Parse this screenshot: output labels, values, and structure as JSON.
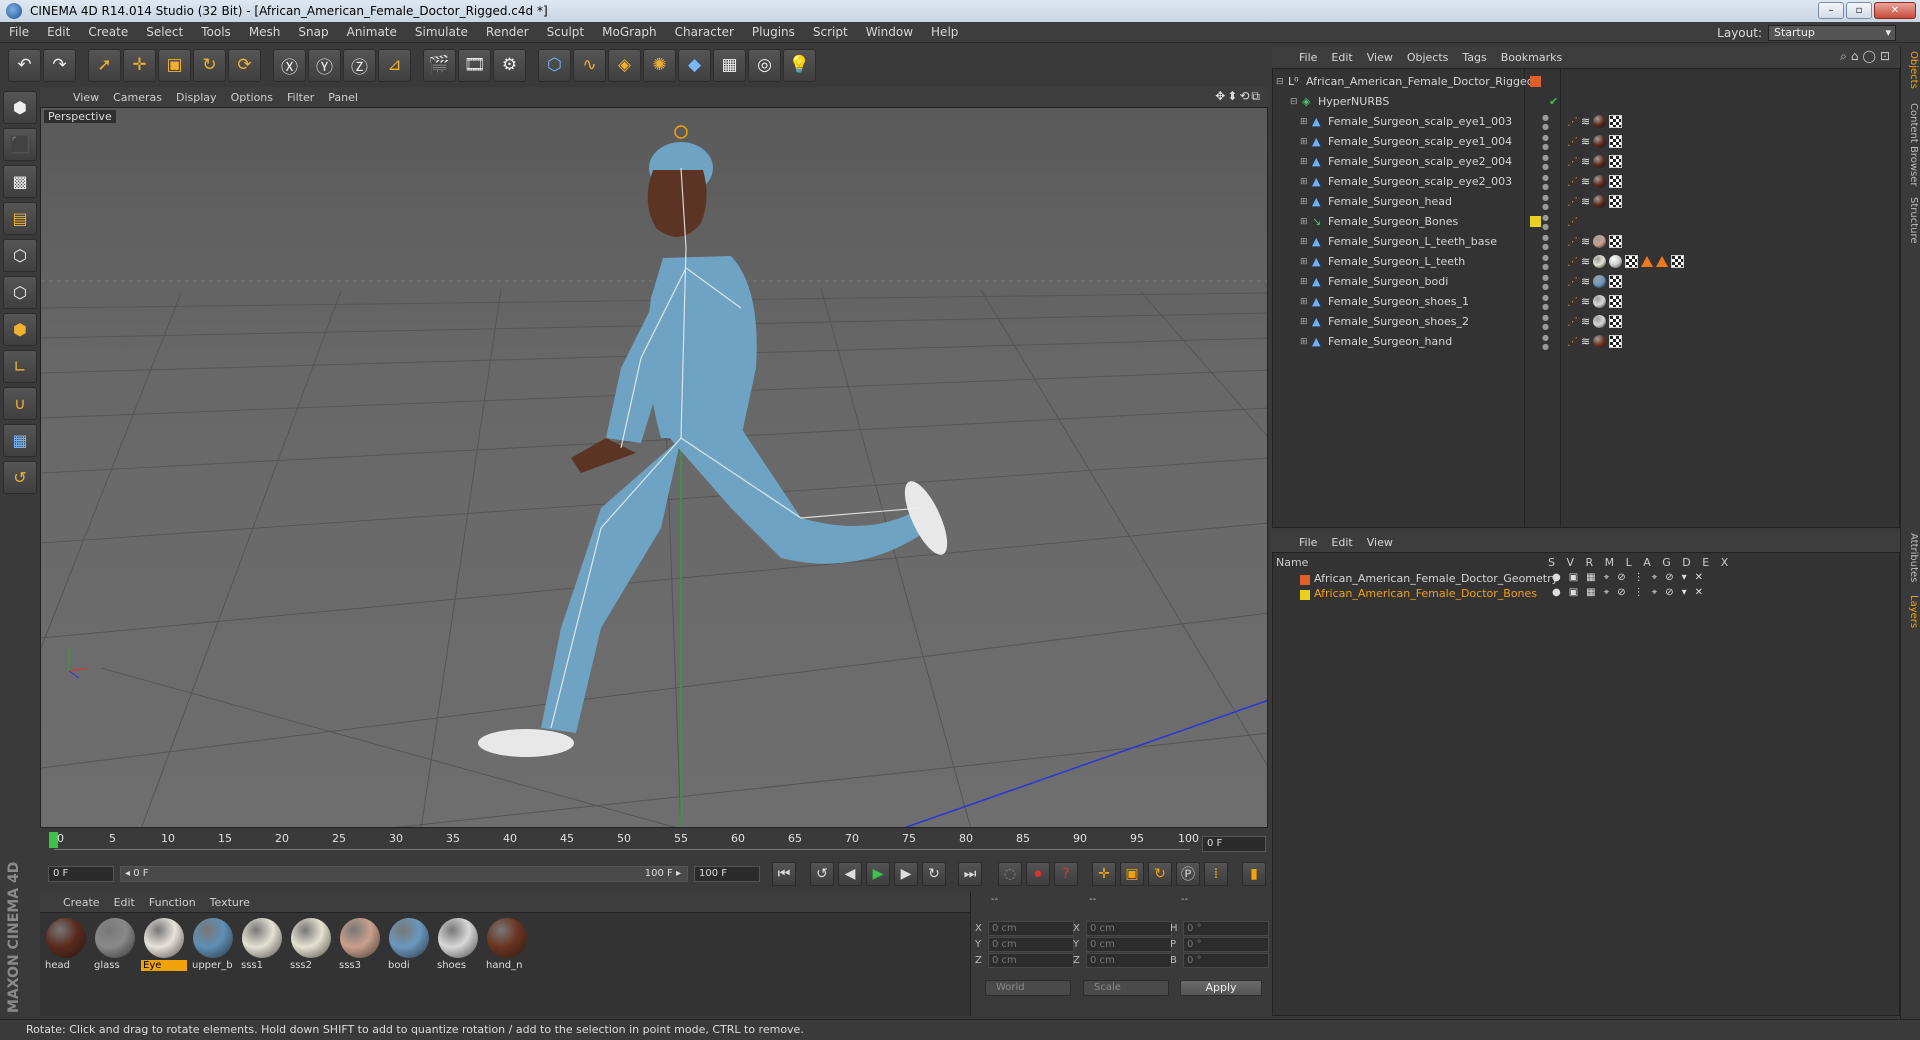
{
  "window": {
    "title": "CINEMA 4D R14.014 Studio (32 Bit) - [African_American_Female_Doctor_Rigged.c4d *]",
    "btn_min": "–",
    "btn_max": "▫",
    "btn_close": "✕"
  },
  "menu": [
    "File",
    "Edit",
    "Create",
    "Select",
    "Tools",
    "Mesh",
    "Snap",
    "Animate",
    "Simulate",
    "Render",
    "Sculpt",
    "MoGraph",
    "Character",
    "Plugins",
    "Script",
    "Window",
    "Help"
  ],
  "layout": {
    "label": "Layout:",
    "value": "Startup"
  },
  "viewport": {
    "menu": [
      "View",
      "Cameras",
      "Display",
      "Options",
      "Filter",
      "Panel"
    ],
    "nav_icons": "✥⬍⟲⧉",
    "label": "Perspective"
  },
  "timeline": {
    "ticks": [
      "0",
      "5",
      "10",
      "15",
      "20",
      "25",
      "30",
      "35",
      "40",
      "45",
      "50",
      "55",
      "60",
      "65",
      "70",
      "75",
      "80",
      "85",
      "90",
      "95",
      "100"
    ],
    "current_frame": "0 F",
    "start": "0 F",
    "range_start": "◂ 0 F",
    "range_end": "100 F ▸",
    "end": "100 F"
  },
  "materials": {
    "menu": [
      "Create",
      "Edit",
      "Function",
      "Texture"
    ],
    "items": [
      {
        "label": "head",
        "color": "#5a2a1c",
        "selected": false
      },
      {
        "label": "glass",
        "color": "#8a8a8a",
        "selected": false
      },
      {
        "label": "Eye",
        "color": "#e8e2dc",
        "selected": true
      },
      {
        "label": "upper_b",
        "color": "#5f8fb5",
        "selected": false
      },
      {
        "label": "sss1",
        "color": "#e4e2d4",
        "selected": false
      },
      {
        "label": "sss2",
        "color": "#e6e2d2",
        "selected": false
      },
      {
        "label": "sss3",
        "color": "#c9a08c",
        "selected": false
      },
      {
        "label": "bodi",
        "color": "#6b98bf",
        "selected": false
      },
      {
        "label": "shoes",
        "color": "#d8d8d8",
        "selected": false
      },
      {
        "label": "hand_n",
        "color": "#6b3420",
        "selected": false
      }
    ]
  },
  "coords": {
    "header": "--",
    "rows": [
      {
        "a": "X",
        "av": "0 cm",
        "b": "X",
        "bv": "0 cm",
        "c": "H",
        "cv": "0 °"
      },
      {
        "a": "Y",
        "av": "0 cm",
        "b": "Y",
        "bv": "0 cm",
        "c": "P",
        "cv": "0 °"
      },
      {
        "a": "Z",
        "av": "0 cm",
        "b": "Z",
        "bv": "0 cm",
        "c": "B",
        "cv": "0 °"
      }
    ],
    "mode": "World",
    "type": "Scale",
    "apply": "Apply"
  },
  "status": "Rotate: Click and drag to rotate elements. Hold down SHIFT to add to quantize rotation / add to the selection in point mode, CTRL to remove.",
  "object_manager": {
    "menu": [
      "File",
      "Edit",
      "View",
      "Objects",
      "Tags",
      "Bookmarks"
    ],
    "icons": "⌕⌂◯⊡",
    "root": "African_American_Female_Doctor_Rigged",
    "hypernurbs": "HyperNURBS",
    "objects": [
      {
        "name": "Female_Surgeon_scalp_eye1_003"
      },
      {
        "name": "Female_Surgeon_scalp_eye1_004"
      },
      {
        "name": "Female_Surgeon_scalp_eye2_004"
      },
      {
        "name": "Female_Surgeon_scalp_eye2_003"
      },
      {
        "name": "Female_Surgeon_head"
      },
      {
        "name": "Female_Surgeon_Bones"
      },
      {
        "name": "Female_Surgeon_L_teeth_base"
      },
      {
        "name": "Female_Surgeon_L_teeth"
      },
      {
        "name": "Female_Surgeon_bodi"
      },
      {
        "name": "Female_Surgeon_shoes_1"
      },
      {
        "name": "Female_Surgeon_shoes_2"
      },
      {
        "name": "Female_Surgeon_hand"
      }
    ]
  },
  "layer_manager": {
    "menu": [
      "File",
      "Edit",
      "View"
    ],
    "col_name": "Name",
    "col_flags": "S V R M L A G D E X",
    "layers": [
      {
        "name": "African_American_Female_Doctor_Geometry",
        "color": "#e0602a",
        "text_color": "#d6d6d6"
      },
      {
        "name": "African_American_Female_Doctor_Bones",
        "color": "#e8d020",
        "text_color": "#f2a20a"
      }
    ]
  },
  "side_tabs": [
    "Objects",
    "Content Browser",
    "Structure",
    "Attributes",
    "Layers"
  ]
}
